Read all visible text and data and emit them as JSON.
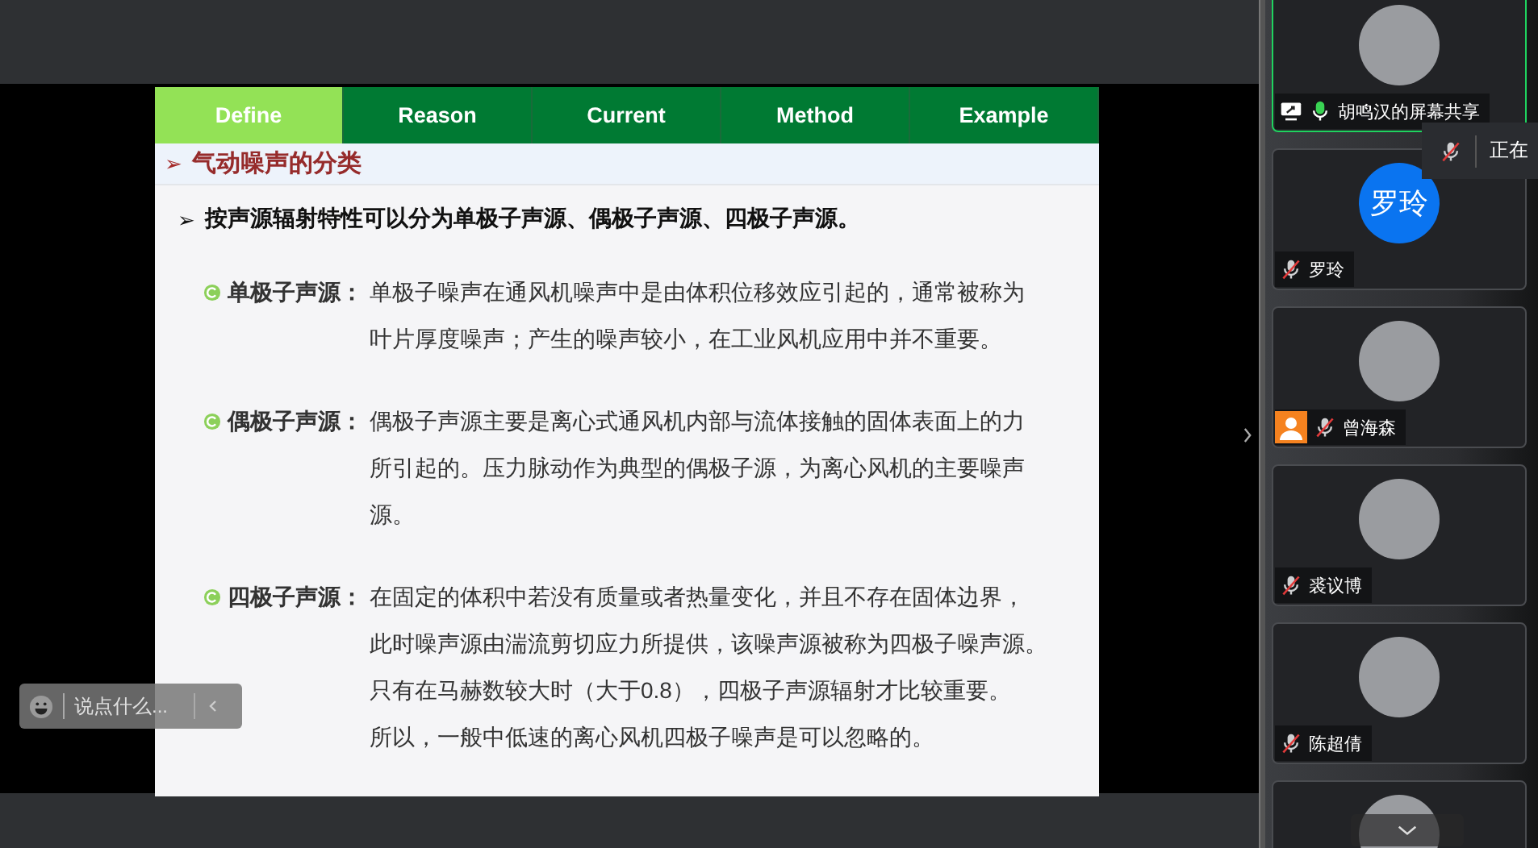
{
  "slide": {
    "tabs": [
      {
        "label": "Define",
        "selected": true
      },
      {
        "label": "Reason",
        "selected": false
      },
      {
        "label": "Current",
        "selected": false
      },
      {
        "label": "Method",
        "selected": false
      },
      {
        "label": "Example",
        "selected": false
      }
    ],
    "heading_marker": "➢",
    "heading": "气动噪声的分类",
    "intro_marker": "➢",
    "intro": "按声源辐射特性可以分为单极子声源、偶极子声源、四极子声源。",
    "items": [
      {
        "term": "单极子声源：",
        "lines": [
          "单极子噪声在通风机噪声中是由体积位移效应引起的，通常被称为",
          "叶片厚度噪声；产生的噪声较小，在工业风机应用中并不重要。"
        ]
      },
      {
        "term": "偶极子声源：",
        "lines": [
          "偶极子声源主要是离心式通风机内部与流体接触的固体表面上的力",
          "所引起的。压力脉动作为典型的偶极子源，为离心风机的主要噪声",
          "源。"
        ]
      },
      {
        "term": "四极子声源：",
        "lines": [
          "在固定的体积中若没有质量或者热量变化，并且不存在固体边界，",
          "此时噪声源由湍流剪切应力所提供，该噪声源被称为四极子噪声源。",
          "只有在马赫数较大时（大于0.8），四极子声源辐射才比较重要。",
          "所以，一般中低速的离心风机四极子噪声是可以忽略的。"
        ]
      }
    ]
  },
  "chat": {
    "placeholder": "说点什么..."
  },
  "speaking_popup": {
    "muted": true,
    "text": "正在"
  },
  "participants": [
    {
      "name": "胡鸣汉的屏幕共享",
      "kind": "photo",
      "sharing": true,
      "muted": false,
      "active": true,
      "guest": false
    },
    {
      "name": "罗玲",
      "kind": "initials",
      "initials": "罗玲",
      "sharing": false,
      "muted": true,
      "active": false,
      "guest": false
    },
    {
      "name": "曾海森",
      "kind": "photo",
      "sharing": false,
      "muted": true,
      "active": false,
      "guest": true
    },
    {
      "name": "裘议博",
      "kind": "photo",
      "sharing": false,
      "muted": true,
      "active": false,
      "guest": false
    },
    {
      "name": "陈超倩",
      "kind": "photo",
      "sharing": false,
      "muted": true,
      "active": false,
      "guest": false
    },
    {
      "kind": "photo",
      "sharing": false,
      "active": false,
      "guest": false
    }
  ]
}
